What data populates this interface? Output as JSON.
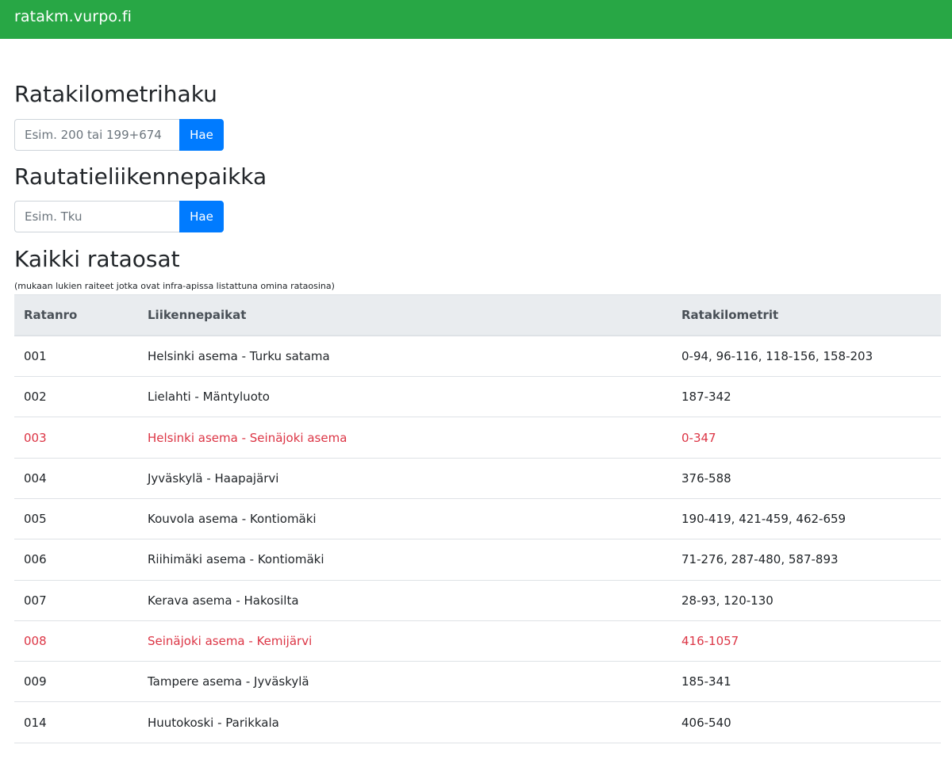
{
  "navbar": {
    "brand": "ratakm.vurpo.fi",
    "color": "#28a745"
  },
  "ratakm_search": {
    "title": "Ratakilometrihaku",
    "placeholder": "Esim. 200 tai 199+674",
    "button": "Hae"
  },
  "place_search": {
    "title": "Rautatieliikennepaikka",
    "placeholder": "Esim. Tku",
    "button": "Hae"
  },
  "all_sections": {
    "title": "Kaikki rataosat",
    "note": "(mukaan lukien raiteet jotka ovat infra-apissa listattuna omina rataosina)",
    "headers": [
      "Ratanro",
      "Liikennepaikat",
      "Ratakilometrit"
    ],
    "highlight_color": "#dc3545",
    "rows": [
      {
        "nro": "001",
        "places": "Helsinki asema - Turku satama",
        "km": "0-94, 96-116, 118-156, 158-203",
        "highlight": false
      },
      {
        "nro": "002",
        "places": "Lielahti - Mäntyluoto",
        "km": "187-342",
        "highlight": false
      },
      {
        "nro": "003",
        "places": "Helsinki asema - Seinäjoki asema",
        "km": "0-347",
        "highlight": true
      },
      {
        "nro": "004",
        "places": "Jyväskylä - Haapajärvi",
        "km": "376-588",
        "highlight": false
      },
      {
        "nro": "005",
        "places": "Kouvola asema - Kontiomäki",
        "km": "190-419, 421-459, 462-659",
        "highlight": false
      },
      {
        "nro": "006",
        "places": "Riihimäki asema - Kontiomäki",
        "km": "71-276, 287-480, 587-893",
        "highlight": false
      },
      {
        "nro": "007",
        "places": "Kerava asema - Hakosilta",
        "km": "28-93, 120-130",
        "highlight": false
      },
      {
        "nro": "008",
        "places": "Seinäjoki asema - Kemijärvi",
        "km": "416-1057",
        "highlight": true
      },
      {
        "nro": "009",
        "places": "Tampere asema - Jyväskylä",
        "km": "185-341",
        "highlight": false
      },
      {
        "nro": "014",
        "places": "Huutokoski - Parikkala",
        "km": "406-540",
        "highlight": false
      }
    ]
  }
}
